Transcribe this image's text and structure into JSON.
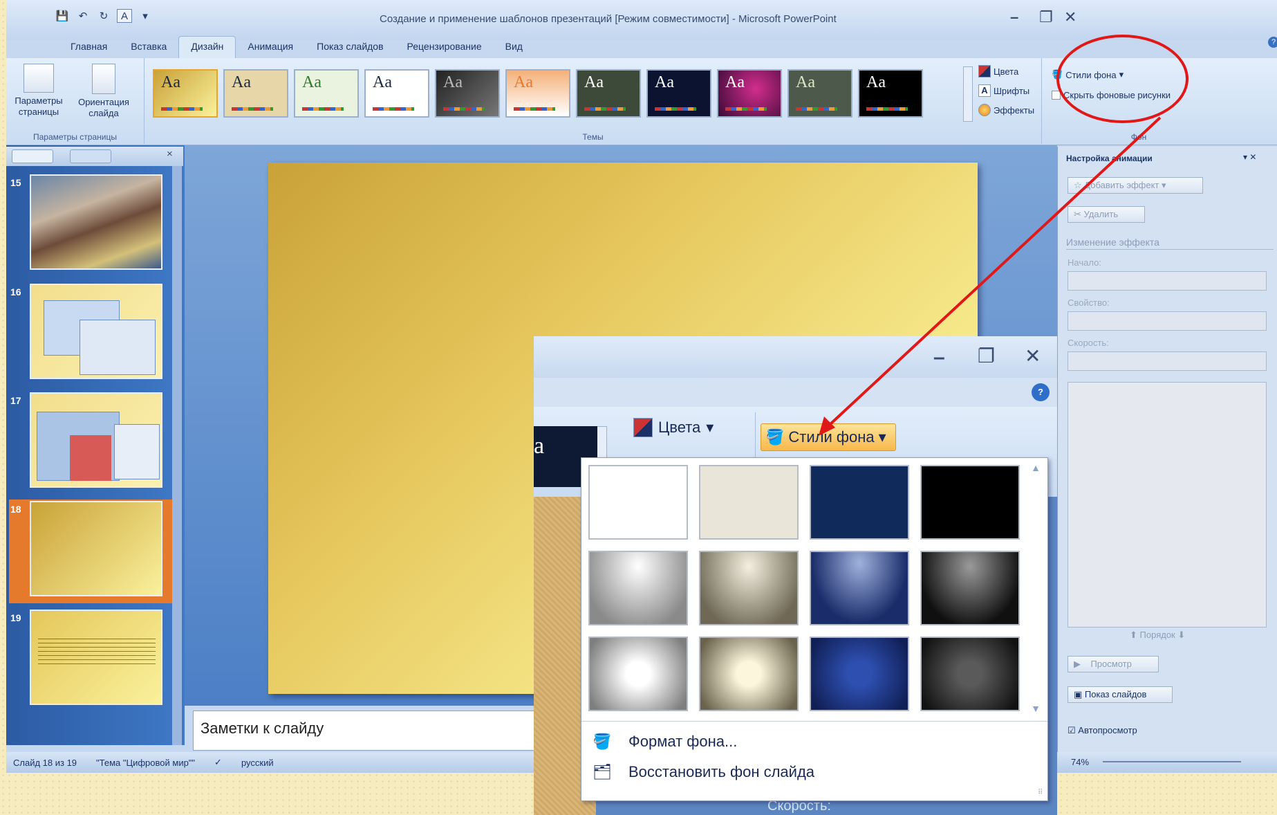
{
  "window": {
    "title": "Создание и применение шаблонов презентаций [Режим совместимости] - Microsoft PowerPoint",
    "controls": {
      "minimize": "–",
      "restore": "❐",
      "close": "✕"
    }
  },
  "qat": {
    "save": "💾",
    "undo": "↶",
    "redo": "↻",
    "format": "A",
    "more": "▾"
  },
  "tabs": [
    "Главная",
    "Вставка",
    "Дизайн",
    "Анимация",
    "Показ слайдов",
    "Рецензирование",
    "Вид"
  ],
  "active_tab": "Дизайн",
  "ribbon": {
    "page_setup": {
      "page_params": "Параметры страницы",
      "orientation": "Ориентация слайда",
      "group_label": "Параметры страницы"
    },
    "themes": {
      "label": "Темы",
      "sample": "Aa"
    },
    "theme_options": {
      "colors": "Цвета",
      "fonts": "Шрифты",
      "effects": "Эффекты"
    },
    "background": {
      "styles": "Стили фона",
      "hide": "Скрыть фоновые рисунки",
      "group_label": "Фон"
    }
  },
  "slides": [
    {
      "num": "15"
    },
    {
      "num": "16"
    },
    {
      "num": "17"
    },
    {
      "num": "18"
    },
    {
      "num": "19"
    }
  ],
  "notes": "Заметки к слайду",
  "status": {
    "slide": "Слайд 18 из 19",
    "theme": "\"Тема \"Цифровой мир\"\"",
    "lang": "русский",
    "zoom": "74%"
  },
  "task_pane": {
    "title": "Настройка анимации",
    "add_effect": "Добавить эффект",
    "remove": "Удалить",
    "change_effect": "Изменение эффекта",
    "start": "Начало:",
    "property": "Свойство:",
    "speed": "Скорость:",
    "order": "Порядок",
    "preview": "Просмотр",
    "slideshow": "Показ слайдов",
    "autopreview": "Автопросмотр"
  },
  "zoom": {
    "colors": "Цвета",
    "styles_btn": "Стили фона",
    "theme_sample": "a",
    "format_bg": "Формат фона...",
    "reset_bg": "Восстановить фон слайда",
    "speed": "Скорость:",
    "help": "?"
  },
  "colors": {
    "accent_red": "#e01818",
    "swatches": [
      "#ffffff",
      "#e9e5d8",
      "#102a5c",
      "#000000"
    ]
  }
}
